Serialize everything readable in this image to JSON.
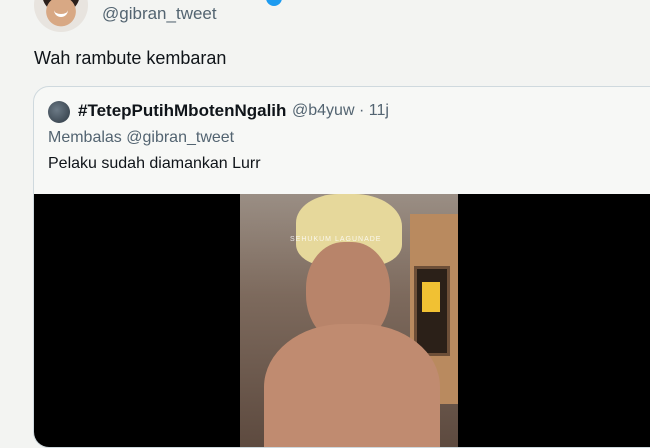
{
  "tweet": {
    "handle": "@gibran_tweet",
    "text": "Wah rambute kembaran"
  },
  "quoted_tweet": {
    "display_name": "#TetepPutihMbotenNgalih",
    "handle": "@b4yuw",
    "separator": "·",
    "time": "11j",
    "reply_prefix": "Membalas @gibran_tweet",
    "text": "Pelaku sudah diamankan Lurr",
    "media": {
      "watermark": "SEHUKUM LAGUNADE"
    }
  },
  "colors": {
    "background": "#f3f4f2",
    "text_primary": "#0f1419",
    "text_secondary": "#536471",
    "verified": "#1d9bf0"
  },
  "icons": [
    "user-avatar-icon",
    "verified-badge-icon",
    "quoted-user-avatar-icon"
  ]
}
